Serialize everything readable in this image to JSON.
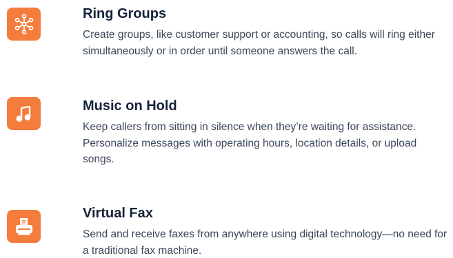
{
  "accent_color": "#f47c3c",
  "features": [
    {
      "icon": "ring-groups-icon",
      "title": "Ring Groups",
      "description": "Create groups, like customer support or accounting, so calls will ring either simultaneously or in order until someone answers the call."
    },
    {
      "icon": "music-note-icon",
      "title": "Music on Hold",
      "description": "Keep callers from sitting in silence when they’re waiting for assistance. Personalize messages with operating hours, location details, or upload songs."
    },
    {
      "icon": "fax-machine-icon",
      "title": "Virtual Fax",
      "description": "Send and receive faxes from anywhere using digital technology—no need for a traditional fax machine."
    }
  ]
}
